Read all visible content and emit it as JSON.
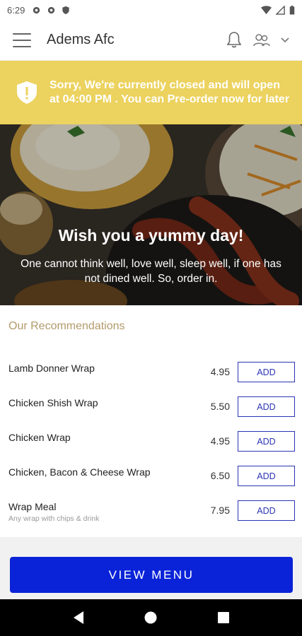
{
  "status_bar": {
    "time": "6:29"
  },
  "header": {
    "title": "Adems Afc",
    "icons": {
      "menu": "hamburger-icon",
      "bell": "bell-icon",
      "user": "user-group-icon",
      "dropdown": "chevron-down-icon"
    }
  },
  "notice": {
    "text": "Sorry, We're currently closed and will open at 04:00 PM . You can Pre-order now for later",
    "icon": "shield-alert-icon",
    "color": "#ecd25e"
  },
  "hero": {
    "title": "Wish you a yummy day!",
    "subtitle": "One cannot think well, love well, sleep well, if one has not dined well. So, order in."
  },
  "recommendations": {
    "title": "Our Recommendations",
    "items": [
      {
        "name": "Lamb Donner Wrap",
        "description": "",
        "price": "4.95",
        "button": "ADD"
      },
      {
        "name": "Chicken Shish Wrap",
        "description": "",
        "price": "5.50",
        "button": "ADD"
      },
      {
        "name": "Chicken Wrap",
        "description": "",
        "price": "4.95",
        "button": "ADD"
      },
      {
        "name": "Chicken, Bacon & Cheese Wrap",
        "description": "",
        "price": "6.50",
        "button": "ADD"
      },
      {
        "name": "Wrap Meal",
        "description": "Any wrap with chips & drink",
        "price": "7.95",
        "button": "ADD"
      }
    ]
  },
  "view_menu": {
    "label": "VIEW MENU",
    "color": "#0a23d8"
  },
  "accent": "#2b34b3"
}
